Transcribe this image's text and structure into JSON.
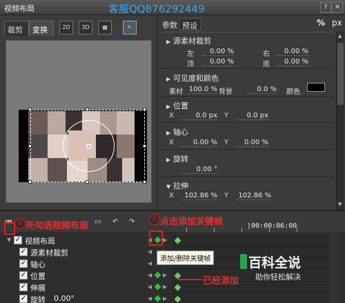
{
  "window": {
    "title": "视频布局",
    "watermark_top": "客服QQ876292449",
    "help_icon": "help-icon",
    "close_icon": "close-icon"
  },
  "left_panel": {
    "tabs": [
      {
        "label": "裁剪",
        "active": false
      },
      {
        "label": "变换",
        "active": true
      }
    ],
    "tools": [
      {
        "label": "2D",
        "icon": "2d-mode-icon"
      },
      {
        "label": "3D",
        "icon": "3d-mode-icon"
      },
      {
        "label": "▦",
        "icon": "grid-icon"
      },
      {
        "label": "↖",
        "icon": "pointer-icon"
      }
    ]
  },
  "right_panel": {
    "tabs": [
      {
        "label": "参数"
      },
      {
        "label": "预设"
      }
    ],
    "percent_label": "%",
    "px_label": "px",
    "sections": {
      "source_crop": {
        "title": "源素材裁剪",
        "left_label": "左",
        "left_value": "0.00 %",
        "right_label": "右",
        "right_value": "0.00 %",
        "top_label": "顶",
        "top_value": "0.00 %",
        "bottom_label": "底",
        "bottom_value": "0.00 %"
      },
      "visibility": {
        "title": "可见度和颜色",
        "material_label": "素材",
        "material_value": "100.0 %",
        "background_label": "背景",
        "background_value": "0.0 %",
        "color_label": "颜色",
        "color_value": "#000000"
      },
      "position": {
        "title": "位置",
        "x_label": "X",
        "x_value": "0.0 px",
        "y_label": "Y",
        "y_value": "0.0 px"
      },
      "pivot": {
        "title": "轴心",
        "x_label": "X",
        "x_value": "0.00 %",
        "y_label": "Y",
        "y_value": "0.00 %"
      },
      "rotation": {
        "title": "旋转",
        "value": "0.00 °"
      },
      "stretch": {
        "title": "拉伸",
        "x_label": "X",
        "x_value": "102.86 %",
        "y_label": "Y",
        "y_value": "102.86 %"
      }
    }
  },
  "timeline": {
    "ruler_time": "|00:00:06:00",
    "tracks": [
      {
        "label": "视频布局",
        "checked": true,
        "indent": 0
      },
      {
        "label": "源素材裁剪",
        "checked": true,
        "indent": 1
      },
      {
        "label": "轴心",
        "checked": true,
        "indent": 1
      },
      {
        "label": "位置",
        "checked": true,
        "indent": 1
      },
      {
        "label": "伸展",
        "checked": true,
        "indent": 1
      },
      {
        "label": "旋转",
        "checked": true,
        "indent": 1,
        "value": "0.00°"
      }
    ],
    "tooltip": "添加/删除关键帧"
  },
  "annotations": {
    "step1_num": "①",
    "step1_text": "先勾选视频布局",
    "step2_num": "②",
    "step2_text": "点击添加关键帧",
    "added_text": "已经添加"
  },
  "logo": {
    "main": "百科全说",
    "sub": "助你轻松解决",
    "badge_color": "#2aa34a"
  },
  "colors": {
    "accent_green": "#3aba3a",
    "annotation_red": "#e02020",
    "watermark_blue": "#3aa7e8"
  }
}
